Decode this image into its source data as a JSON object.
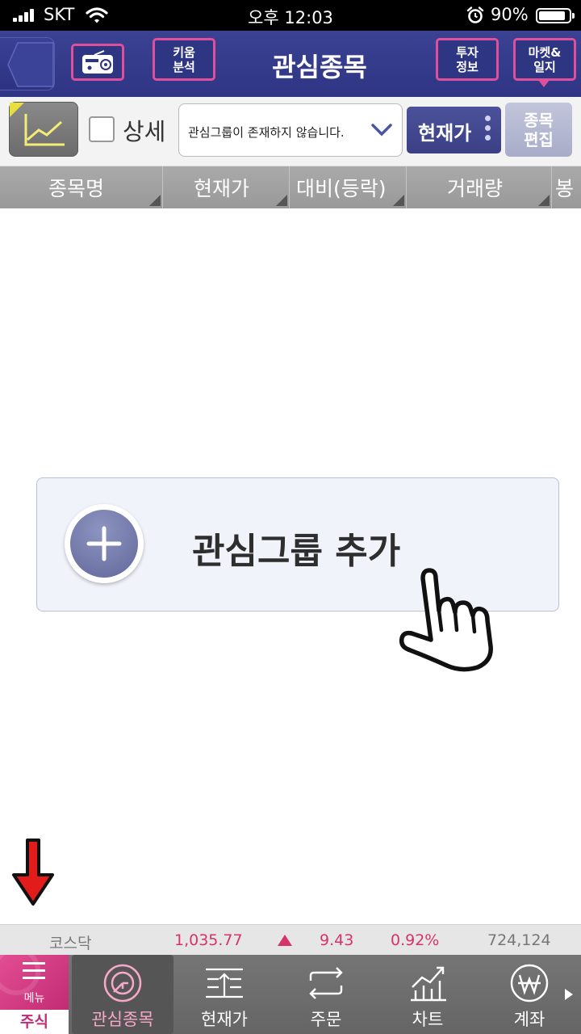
{
  "status_bar": {
    "carrier": "SKT",
    "time": "오후 12:03",
    "battery_percent": "90%",
    "battery_level": 0.9
  },
  "header": {
    "title": "관심종목",
    "kiwoom_button": "키움\n분석",
    "invest_button": "투자\n정보",
    "market_button": "마켓&\n일지",
    "icons": [
      "back-icon",
      "radio-icon"
    ]
  },
  "toolbar": {
    "detail_label": "상세",
    "group_select_value": "관심그룹이 존재하지 않습니다.",
    "price_button": "현재가",
    "edit_button": "종목\n편집"
  },
  "columns": [
    "종목명",
    "현재가",
    "대비(등락)",
    "거래량",
    "봉"
  ],
  "empty_state": {
    "add_group_label": "관심그룹 추가"
  },
  "ticker": {
    "name": "코스닥",
    "value": "1,035.77",
    "change": "9.43",
    "rate": "0.92%",
    "volume": "724,124",
    "direction": "up",
    "up_color": "#d6336c"
  },
  "bottom_nav": {
    "menu_label": "메뉴",
    "stock_tab": "주식",
    "items": [
      {
        "label": "관심종목",
        "icon": "watchlist-icon",
        "active": true
      },
      {
        "label": "현재가",
        "icon": "current-price-icon",
        "active": false
      },
      {
        "label": "주문",
        "icon": "order-icon",
        "active": false
      },
      {
        "label": "차트",
        "icon": "chart-icon",
        "active": false
      },
      {
        "label": "계좌",
        "icon": "account-won-icon",
        "active": false
      }
    ]
  },
  "colors": {
    "header_bg": "#343a8a",
    "accent_pink": "#e0509a",
    "up_red": "#d6336c"
  }
}
